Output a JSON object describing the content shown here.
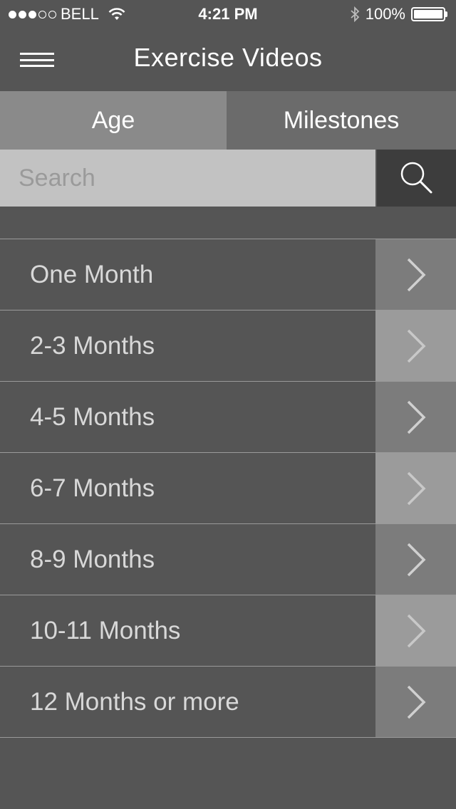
{
  "status_bar": {
    "carrier": "BELL",
    "time": "4:21 PM",
    "battery": "100%",
    "signal_strength": 3,
    "signal_max": 5
  },
  "navbar": {
    "title": "Exercise Videos",
    "menu_icon": "hamburger-icon"
  },
  "tabs": [
    {
      "label": "Age",
      "selected": true
    },
    {
      "label": "Milestones",
      "selected": false
    }
  ],
  "search": {
    "placeholder": "Search",
    "value": "",
    "icon": "search-icon"
  },
  "list": {
    "items": [
      {
        "label": "One Month"
      },
      {
        "label": "2-3 Months"
      },
      {
        "label": "4-5 Months"
      },
      {
        "label": "6-7 Months"
      },
      {
        "label": "8-9 Months"
      },
      {
        "label": "10-11 Months"
      },
      {
        "label": "12 Months or more"
      }
    ],
    "arrow_icon": "chevron-right-icon"
  },
  "colors": {
    "background": "#555555",
    "tab_selected": "#8a8a8a",
    "tab_unselected": "#6b6b6b",
    "search_field": "#c2c2c2",
    "search_button": "#3d3d3d",
    "arrow_cell_dark": "#7c7c7c",
    "arrow_cell_light": "#9b9b9b"
  }
}
